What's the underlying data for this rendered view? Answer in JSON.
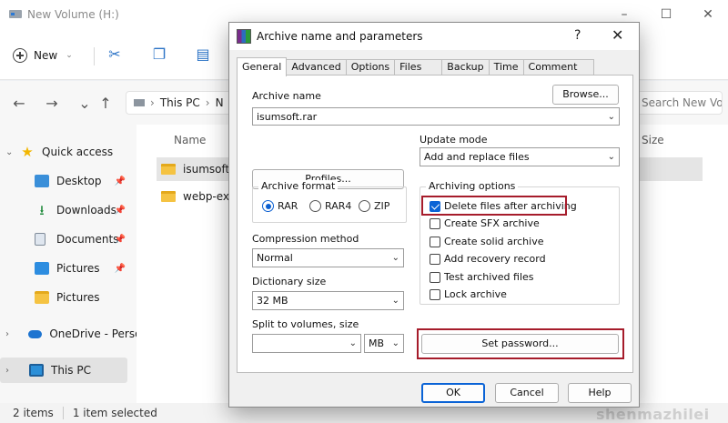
{
  "explorer": {
    "title": "New Volume (H:)",
    "toolbar": {
      "new_label": "New"
    },
    "address": {
      "segment1": "This PC",
      "segment2": "N"
    },
    "search_placeholder": "Search New Volu...",
    "sidebar": {
      "items": [
        {
          "label": "Quick access",
          "icon": "star-icon"
        },
        {
          "label": "Desktop",
          "icon": "desktop-icon"
        },
        {
          "label": "Downloads",
          "icon": "download-icon"
        },
        {
          "label": "Documents",
          "icon": "documents-icon"
        },
        {
          "label": "Pictures",
          "icon": "pictures-icon"
        },
        {
          "label": "Pictures",
          "icon": "folder-icon"
        },
        {
          "label": "OneDrive - Perso",
          "icon": "cloud-icon"
        },
        {
          "label": "This PC",
          "icon": "computer-icon"
        }
      ]
    },
    "columns": {
      "name": "Name",
      "size": "Size"
    },
    "files": [
      {
        "name": "isumsoft"
      },
      {
        "name": "webp-exp"
      }
    ],
    "status": {
      "items": "2 items",
      "selected": "1 item selected"
    },
    "watermark": "shenmazhilei"
  },
  "dialog": {
    "title": "Archive name and parameters",
    "help_glyph": "?",
    "close_glyph": "✕",
    "tabs": [
      "General",
      "Advanced",
      "Options",
      "Files",
      "Backup",
      "Time",
      "Comment"
    ],
    "archive_name_label": "Archive name",
    "archive_name_value": "isumsoft.rar",
    "browse_label": "Browse...",
    "profiles_label": "Profiles...",
    "update_mode_label": "Update mode",
    "update_mode_value": "Add and replace files",
    "archive_format_label": "Archive format",
    "formats": [
      "RAR",
      "RAR4",
      "ZIP"
    ],
    "selected_format": "RAR",
    "compression_label": "Compression method",
    "compression_value": "Normal",
    "dictionary_label": "Dictionary size",
    "dictionary_value": "32 MB",
    "split_label": "Split to volumes, size",
    "split_value": "",
    "split_unit": "MB",
    "archiving_options_label": "Archiving options",
    "options": [
      {
        "label": "Delete files after archiving",
        "checked": true
      },
      {
        "label": "Create SFX archive",
        "checked": false
      },
      {
        "label": "Create solid archive",
        "checked": false
      },
      {
        "label": "Add recovery record",
        "checked": false
      },
      {
        "label": "Test archived files",
        "checked": false
      },
      {
        "label": "Lock archive",
        "checked": false
      }
    ],
    "set_password_label": "Set password...",
    "ok_label": "OK",
    "cancel_label": "Cancel",
    "help_label": "Help",
    "colors": {
      "highlight": "#a61c2b",
      "accent": "#0a63d6"
    }
  }
}
